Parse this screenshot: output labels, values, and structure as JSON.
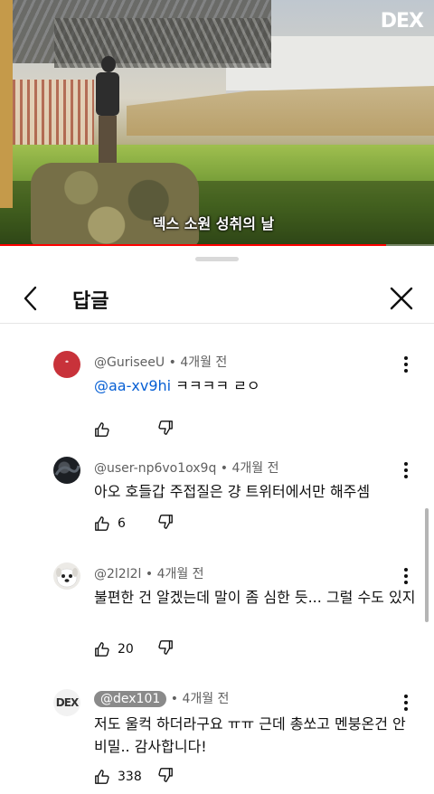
{
  "video": {
    "caption": "덱스 소원 성취의 날",
    "logo": "DEX",
    "progress_fraction": 0.89,
    "progress_color": "#ff0000"
  },
  "panel": {
    "title": "답글"
  },
  "comments": [
    {
      "author": "@GuriseeU",
      "time": "4개월 전",
      "mention": "@aa-xv9hi",
      "text": " ㅋㅋㅋㅋ ㄹㅇ",
      "likes": "",
      "avatar": "red-circle"
    },
    {
      "author": "@user-np6vo1ox9q",
      "time": "4개월 전",
      "text": "아오 호들갑 주접질은 걍 트위터에서만 해주셈",
      "likes": "6",
      "avatar": "dark-pattern"
    },
    {
      "author": "@2l2l2l",
      "time": "4개월 전",
      "text": "불편한 건 알겠는데 말이 좀 심한 듯... 그럴 수도 있지",
      "likes": "20",
      "avatar": "white-dog"
    },
    {
      "author": "@dex101",
      "time": "4개월 전",
      "text": "저도 울컥 하더라구요 ㅠㅠ 근데 총쏘고 멘붕온건 안비밀.. 감사합니다!",
      "likes": "338",
      "avatar": "dex-logo",
      "avatar_text": "DEX"
    }
  ],
  "colors": {
    "link": "#065fd4",
    "meta": "#606060",
    "accent": "#ff0000"
  },
  "icons": [
    "back-arrow-icon",
    "close-icon",
    "more-vertical-icon",
    "thumb-up-icon",
    "thumb-down-icon"
  ]
}
